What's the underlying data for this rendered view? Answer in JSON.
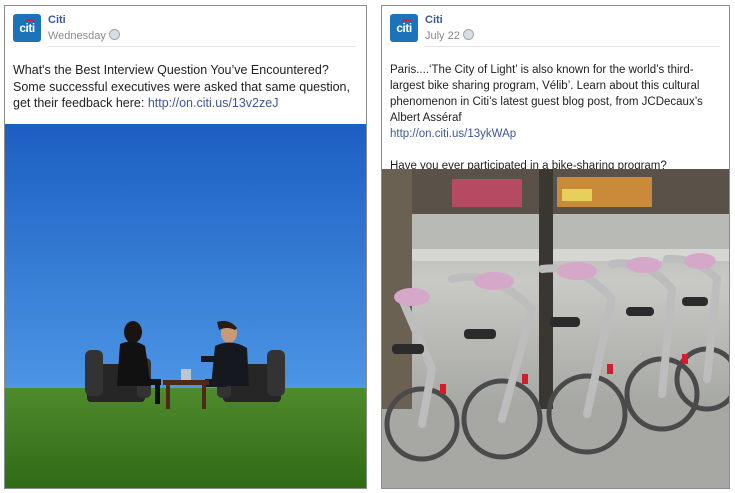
{
  "post_left": {
    "page_name": "Citi",
    "timestamp": "Wednesday",
    "avatar_text": "citi",
    "message": "What's the Best Interview Question You’ve Encountered? Some successful executives were asked that same question, get their feedback here: ",
    "link": "http://on.citi.us/13v2zeJ"
  },
  "post_right": {
    "page_name": "Citi",
    "timestamp": "July 22",
    "avatar_text": "citi",
    "message": "Paris....‘The City of Light’ is also known for the world’s third-largest bike sharing program, Vélib’. Learn about this cultural phenomenon in Citi’s latest guest blog post, from JCDecaux’s Albert Asséraf",
    "link": "http://on.citi.us/13ykWAp",
    "question": "Have you ever participated in a bike-sharing program?"
  },
  "colors": {
    "brand_blue": "#1d73ba",
    "link_blue": "#3b5998",
    "accent_red": "#e5172e"
  },
  "icons": {
    "privacy": "globe-icon"
  }
}
